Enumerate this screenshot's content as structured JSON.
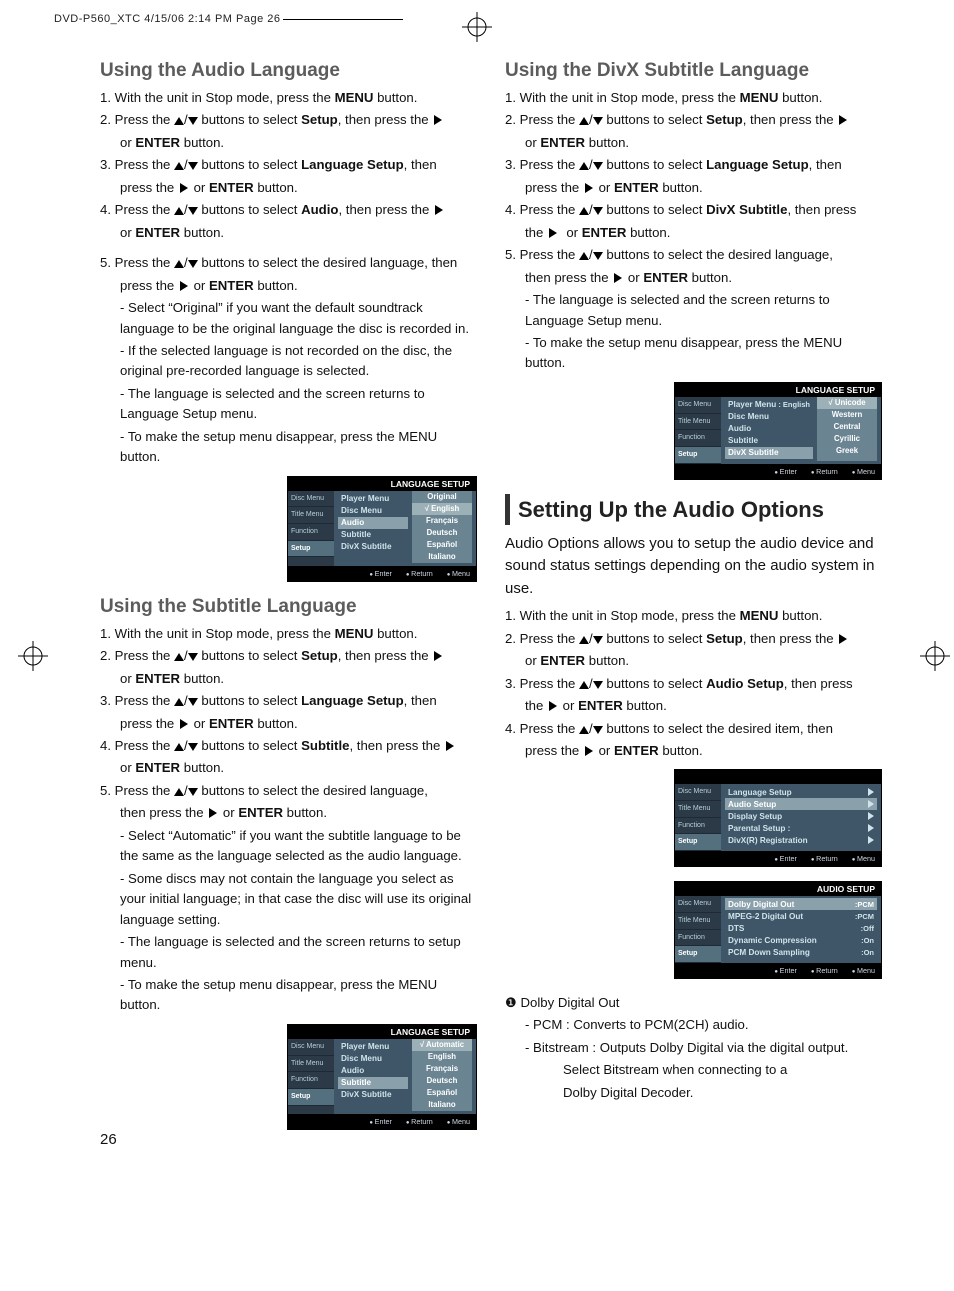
{
  "slug": "DVD-P560_XTC  4/15/06  2:14 PM  Page 26",
  "page_number": "26",
  "left": {
    "h_audio": "Using the Audio Language",
    "audio_steps": [
      {
        "pre": "1. With the unit in Stop mode, press the ",
        "bold": "MENU",
        "post": " button."
      },
      {
        "pre": "2. Press the ",
        "mid": " buttons to select ",
        "bold": "Setup",
        "post": ", then press the "
      },
      {
        "enter": "ENTER",
        "or": "or ",
        "tail": " button."
      },
      {
        "pre": "3. Press the ",
        "mid": " buttons to select ",
        "bold": "Language Setup",
        "post": ", then"
      },
      {
        "sub": "press the ",
        "enter": "ENTER",
        "or": " or ",
        "tail": " button."
      },
      {
        "pre": "4. Press the ",
        "mid": " buttons to select ",
        "bold": "Audio",
        "post": ", then press the "
      },
      {
        "enter": "ENTER",
        "or": "or ",
        "tail": " button."
      },
      {
        "pre": "5. Press the ",
        "mid": " buttons to select the desired language, then"
      },
      {
        "sub": "press the ",
        "enter": "ENTER",
        "or": " or ",
        "tail": " button."
      }
    ],
    "audio_notes": [
      "- Select “Original” if you want the default soundtrack language to be the original language the disc is recorded in.",
      "- If the selected language is not recorded on the disc, the original pre-recorded language is selected.",
      "- The language is selected and the screen returns to Language Setup menu.",
      "- To make the setup menu disappear, press the MENU button."
    ],
    "h_subtitle": "Using the Subtitle Language",
    "sub_notes": [
      "- Select “Automatic” if you want the subtitle  language to be the same as the language selected as the audio language.",
      "- Some discs may not contain the language you select as your initial language; in that case the disc will use its original language setting.",
      "- The language is selected and the screen returns to setup menu.",
      "- To make the setup menu disappear, press the MENU button."
    ]
  },
  "right": {
    "h_divx": "Using the DivX Subtitle Language",
    "divx_notes": [
      "- The language is selected and the screen returns to Language Setup menu.",
      "- To make the setup menu disappear, press the MENU button."
    ],
    "h_audioopt": "Setting Up the Audio Options",
    "audioopt_intro": "Audio Options allows you to setup the audio device and sound status settings depending on the audio system in use.",
    "dolby_label": "Dolby Digital Out",
    "dolby_pcm": "- PCM : Converts to PCM(2CH) audio.",
    "dolby_bit1": "- Bitstream : Outputs Dolby Digital via the digital output.",
    "dolby_bit2": "Select Bitstream when connecting to a",
    "dolby_bit3": "Dolby Digital Decoder."
  },
  "osd": {
    "title_lang": "LANGUAGE SETUP",
    "tabs": [
      "Disc Menu",
      "Title Menu",
      "Function",
      "Setup"
    ],
    "menu_items": [
      "Player Menu",
      "Disc Menu",
      "Audio",
      "Subtitle",
      "DivX Subtitle"
    ],
    "popup_audio": [
      "Original",
      "English",
      "Français",
      "Deutsch",
      "Español",
      "Italiano"
    ],
    "popup_subtitle": [
      "Automatic",
      "English",
      "Français",
      "Deutsch",
      "Español",
      "Italiano"
    ],
    "popup_divx": [
      "Unicode",
      "Western",
      "Central",
      "Cyrillic",
      "Greek"
    ],
    "divx_player_value": ": English",
    "footer": [
      "Enter",
      "Return",
      "Menu"
    ],
    "setup_rows": [
      "Language Setup",
      "Audio Setup",
      "Display Setup",
      "Parental Setup :",
      "DivX(R) Registration"
    ],
    "title_audio": "AUDIO SETUP",
    "audio_rows": [
      [
        "Dolby Digital Out",
        ":PCM"
      ],
      [
        "MPEG-2 Digital Out",
        ":PCM"
      ],
      [
        "DTS",
        ":Off"
      ],
      [
        "Dynamic Compression",
        ":On"
      ],
      [
        "PCM Down Sampling",
        ":On"
      ]
    ]
  }
}
